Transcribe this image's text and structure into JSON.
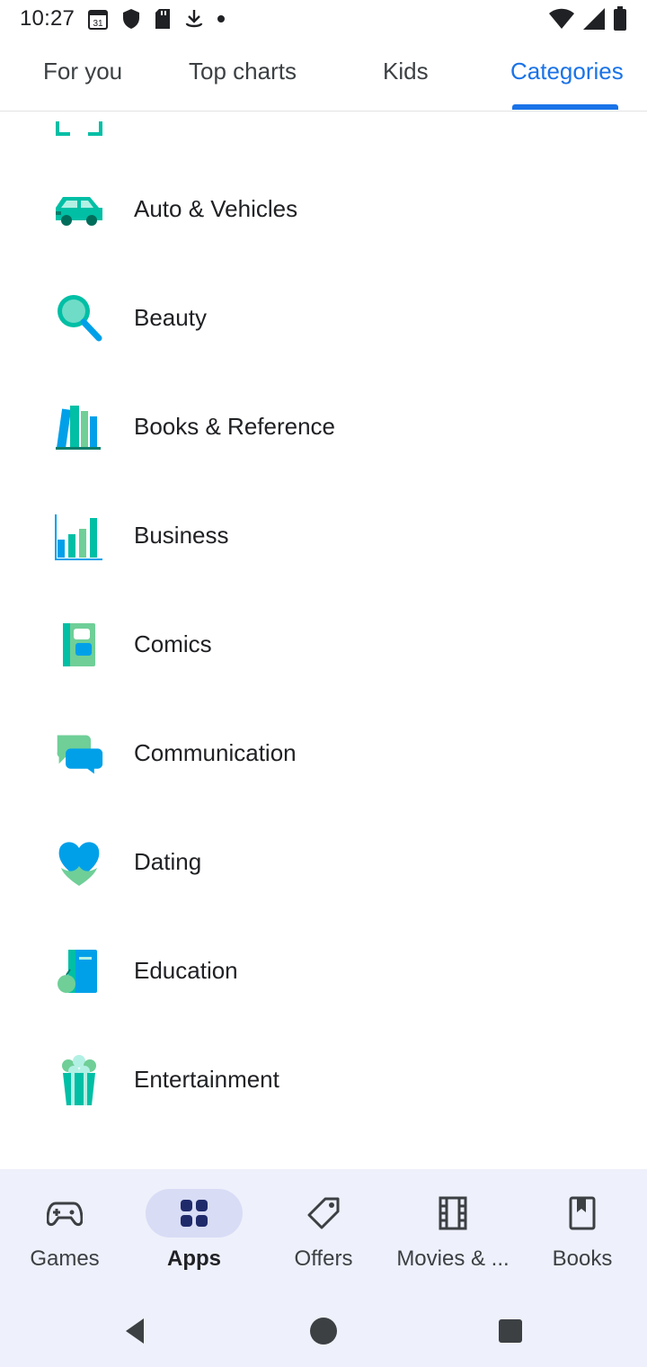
{
  "status_bar": {
    "time": "10:27",
    "left_icons": [
      "calendar-icon",
      "shield-icon",
      "sd-card-icon",
      "download-icon",
      "dot-icon"
    ],
    "calendar_day": "31",
    "right_icons": [
      "wifi-icon",
      "signal-icon",
      "battery-icon"
    ]
  },
  "top_tabs": {
    "items": [
      {
        "label": "For you",
        "active": false
      },
      {
        "label": "Top charts",
        "active": false
      },
      {
        "label": "Kids",
        "active": false
      },
      {
        "label": "Categories",
        "active": true
      }
    ]
  },
  "categories": [
    {
      "label": "Auto & Vehicles",
      "icon": "car-icon"
    },
    {
      "label": "Beauty",
      "icon": "mirror-icon"
    },
    {
      "label": "Books & Reference",
      "icon": "books-icon"
    },
    {
      "label": "Business",
      "icon": "bar-chart-icon"
    },
    {
      "label": "Comics",
      "icon": "comic-book-icon"
    },
    {
      "label": "Communication",
      "icon": "chat-bubbles-icon"
    },
    {
      "label": "Dating",
      "icon": "hearts-icon"
    },
    {
      "label": "Education",
      "icon": "book-apple-icon"
    },
    {
      "label": "Entertainment",
      "icon": "popcorn-icon"
    }
  ],
  "bottom_nav": {
    "items": [
      {
        "label": "Games",
        "icon": "gamepad-icon",
        "active": false
      },
      {
        "label": "Apps",
        "icon": "apps-grid-icon",
        "active": true
      },
      {
        "label": "Offers",
        "icon": "tag-icon",
        "active": false
      },
      {
        "label": "Movies & ...",
        "icon": "film-icon",
        "active": false
      },
      {
        "label": "Books",
        "icon": "bookmark-icon",
        "active": false
      }
    ]
  },
  "system_nav": [
    "back-icon",
    "home-icon",
    "recents-icon"
  ],
  "colors": {
    "accent": "#1a73e8",
    "nav_background": "#eef0fb",
    "nav_active_pill": "#d8dcf5",
    "icon_teal": "#00bfa5",
    "icon_blue": "#00a0e9",
    "icon_green": "#6fcf97"
  }
}
